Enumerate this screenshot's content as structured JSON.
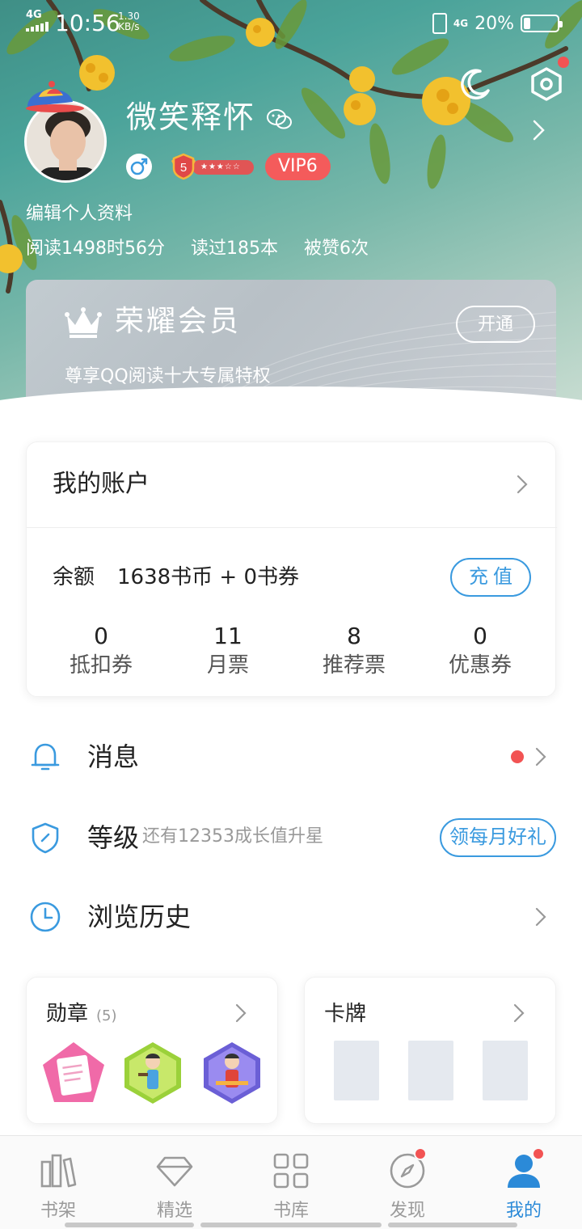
{
  "status_bar": {
    "network": "4G",
    "time": "10:56",
    "speed_value": "1.30",
    "speed_unit": "KB/s",
    "network2": "4G",
    "battery": "20%",
    "battery_level": 0.2
  },
  "profile": {
    "username": "微笑释怀",
    "level": "5",
    "vip": "VIP6",
    "edit_label": "编辑个人资料",
    "stats": [
      "阅读1498时56分",
      "读过185本",
      "被赞6次"
    ],
    "icons": [
      "moon-icon",
      "hexagon-settings-icon",
      "wechat-icon",
      "male-gender-icon",
      "level-shield-icon",
      "chevron-right-icon"
    ]
  },
  "vip_card": {
    "title": "荣耀会员",
    "subtitle": "尊享QQ阅读十大专属特权",
    "button": "开通",
    "icon": "crown-icon"
  },
  "account": {
    "title": "我的账户",
    "balance_label": "余额",
    "balance_value": "1638书币 + 0书券",
    "recharge": "充值",
    "stats": [
      {
        "value": "0",
        "label": "抵扣券"
      },
      {
        "value": "11",
        "label": "月票"
      },
      {
        "value": "8",
        "label": "推荐票"
      },
      {
        "value": "0",
        "label": "优惠券"
      }
    ]
  },
  "menu": {
    "messages": "消息",
    "level": "等级",
    "level_sub": "还有12353成长值升星",
    "level_gift": "领每月好礼",
    "history": "浏览历史"
  },
  "medals": {
    "title": "勋章",
    "count": "(5)"
  },
  "cards": {
    "title": "卡牌"
  },
  "tabs": [
    {
      "label": "书架",
      "icon": "bookshelf-icon"
    },
    {
      "label": "精选",
      "icon": "diamond-icon"
    },
    {
      "label": "书库",
      "icon": "grid-icon"
    },
    {
      "label": "发现",
      "icon": "compass-icon"
    },
    {
      "label": "我的",
      "icon": "person-icon"
    }
  ],
  "colors": {
    "accent": "#3a9adf",
    "active_tab": "#2b8ad8",
    "badge_red": "#f25353",
    "vip_pill": "#f45b5b"
  }
}
